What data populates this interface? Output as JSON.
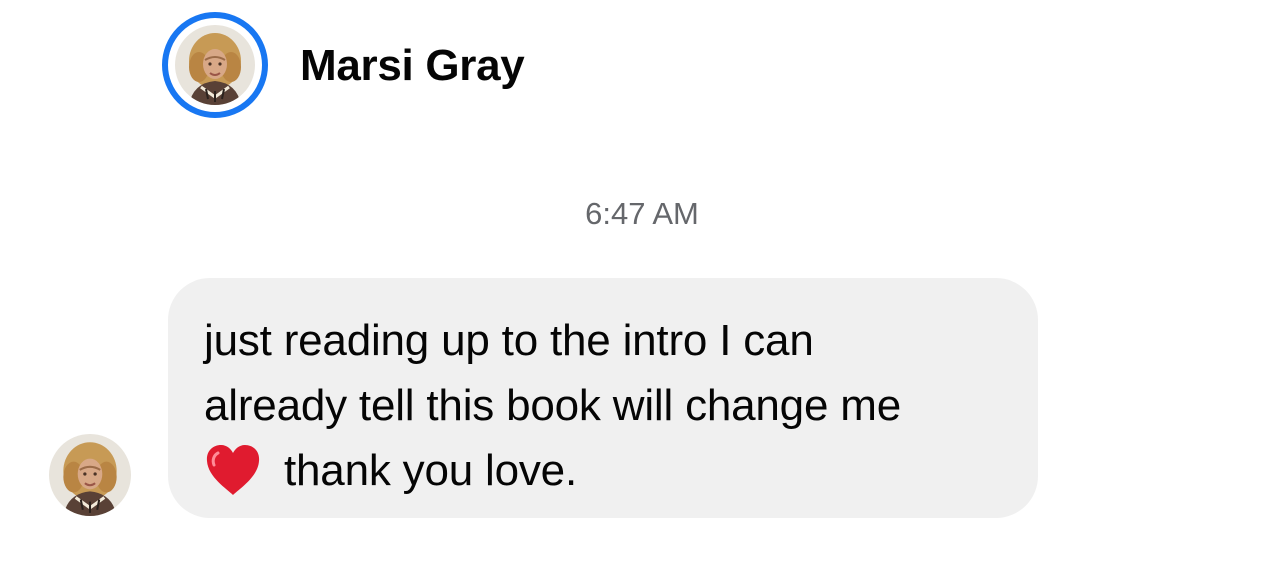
{
  "header": {
    "contact_name": "Marsi Gray",
    "avatar_icon": "profile-photo-avatar",
    "active_ring_color": "#1877f2"
  },
  "thread": {
    "timestamp": "6:47 AM",
    "messages": [
      {
        "sender_avatar_icon": "profile-photo-avatar",
        "lines": [
          "just reading up to the intro I can",
          "already tell this book will change me"
        ],
        "emoji_icon": "red-heart-emoji",
        "last_line_text": "thank you love.",
        "bubble_color": "#f0f0f0"
      }
    ]
  }
}
